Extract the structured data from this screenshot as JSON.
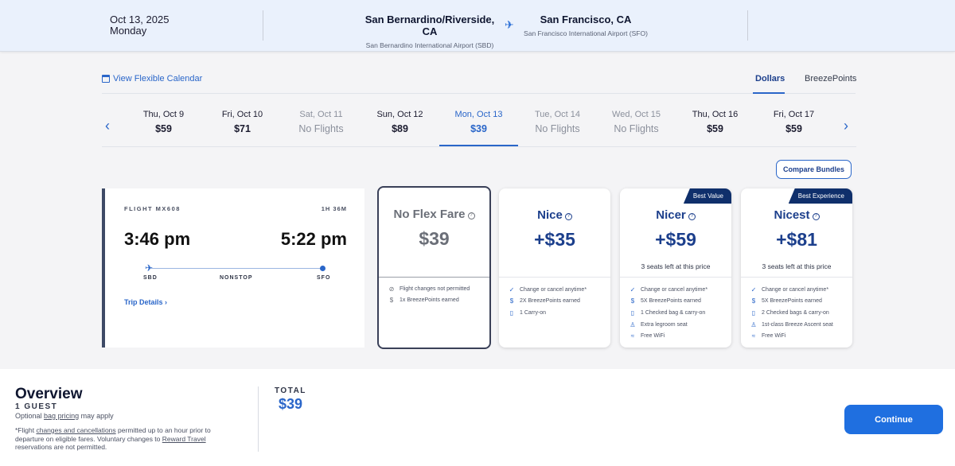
{
  "header": {
    "date": "Oct 13, 2025",
    "weekday": "Monday",
    "origin": {
      "city": "San Bernardino/Riverside, CA",
      "airport": "San Bernardino International Airport (SBD)"
    },
    "destination": {
      "city": "San Francisco, CA",
      "airport": "San Francisco International Airport (SFO)"
    }
  },
  "toolbar": {
    "flex_calendar": "View Flexible Calendar",
    "tabs": [
      "Dollars",
      "BreezePoints"
    ],
    "compare": "Compare Bundles"
  },
  "dates": [
    {
      "label": "Thu, Oct 9",
      "price": "$59"
    },
    {
      "label": "Fri, Oct 10",
      "price": "$71"
    },
    {
      "label": "Sat, Oct 11",
      "price": "No Flights"
    },
    {
      "label": "Sun, Oct 12",
      "price": "$89"
    },
    {
      "label": "Mon, Oct 13",
      "price": "$39"
    },
    {
      "label": "Tue, Oct 14",
      "price": "No Flights"
    },
    {
      "label": "Wed, Oct 15",
      "price": "No Flights"
    },
    {
      "label": "Thu, Oct 16",
      "price": "$59"
    },
    {
      "label": "Fri, Oct 17",
      "price": "$59"
    }
  ],
  "flight": {
    "number": "FLIGHT MX608",
    "duration": "1H 36M",
    "depart": "3:46 pm",
    "arrive": "5:22 pm",
    "from": "SBD",
    "stops": "NONSTOP",
    "to": "SFO",
    "details": "Trip Details"
  },
  "fares": [
    {
      "name": "No Flex Fare",
      "price": "$39",
      "seats": "",
      "badge": "",
      "features": [
        "Flight changes not permitted",
        "1x BreezePoints earned"
      ]
    },
    {
      "name": "Nice",
      "price": "+$35",
      "seats": "",
      "badge": "",
      "features": [
        "Change or cancel anytime*",
        "2X BreezePoints earned",
        "1 Carry-on"
      ]
    },
    {
      "name": "Nicer",
      "price": "+$59",
      "seats": "3 seats left at this price",
      "badge": "Best Value",
      "features": [
        "Change or cancel anytime*",
        "5X BreezePoints earned",
        "1 Checked bag & carry-on",
        "Extra legroom seat",
        "Free WiFi"
      ]
    },
    {
      "name": "Nicest",
      "price": "+$81",
      "seats": "3 seats left at this price",
      "badge": "Best Experience",
      "features": [
        "Change or cancel anytime*",
        "5X BreezePoints earned",
        "2 Checked bags & carry-on",
        "1st-class Breeze Ascent seat",
        "Free WiFi"
      ]
    }
  ],
  "overview": {
    "title": "Overview",
    "guests": "1 GUEST",
    "bag_pre": "Optional",
    "bag_link": "bag pricing",
    "bag_post": "may apply",
    "note_1": "*Flight",
    "note_link_1": "changes and cancellations",
    "note_2": "permitted up to an hour prior to departure on eligible fares. Voluntary changes to",
    "note_link_2": "Reward Travel",
    "note_3": "reservations are not permitted.",
    "total_label": "TOTAL",
    "total": "$39",
    "continue": "Continue"
  }
}
